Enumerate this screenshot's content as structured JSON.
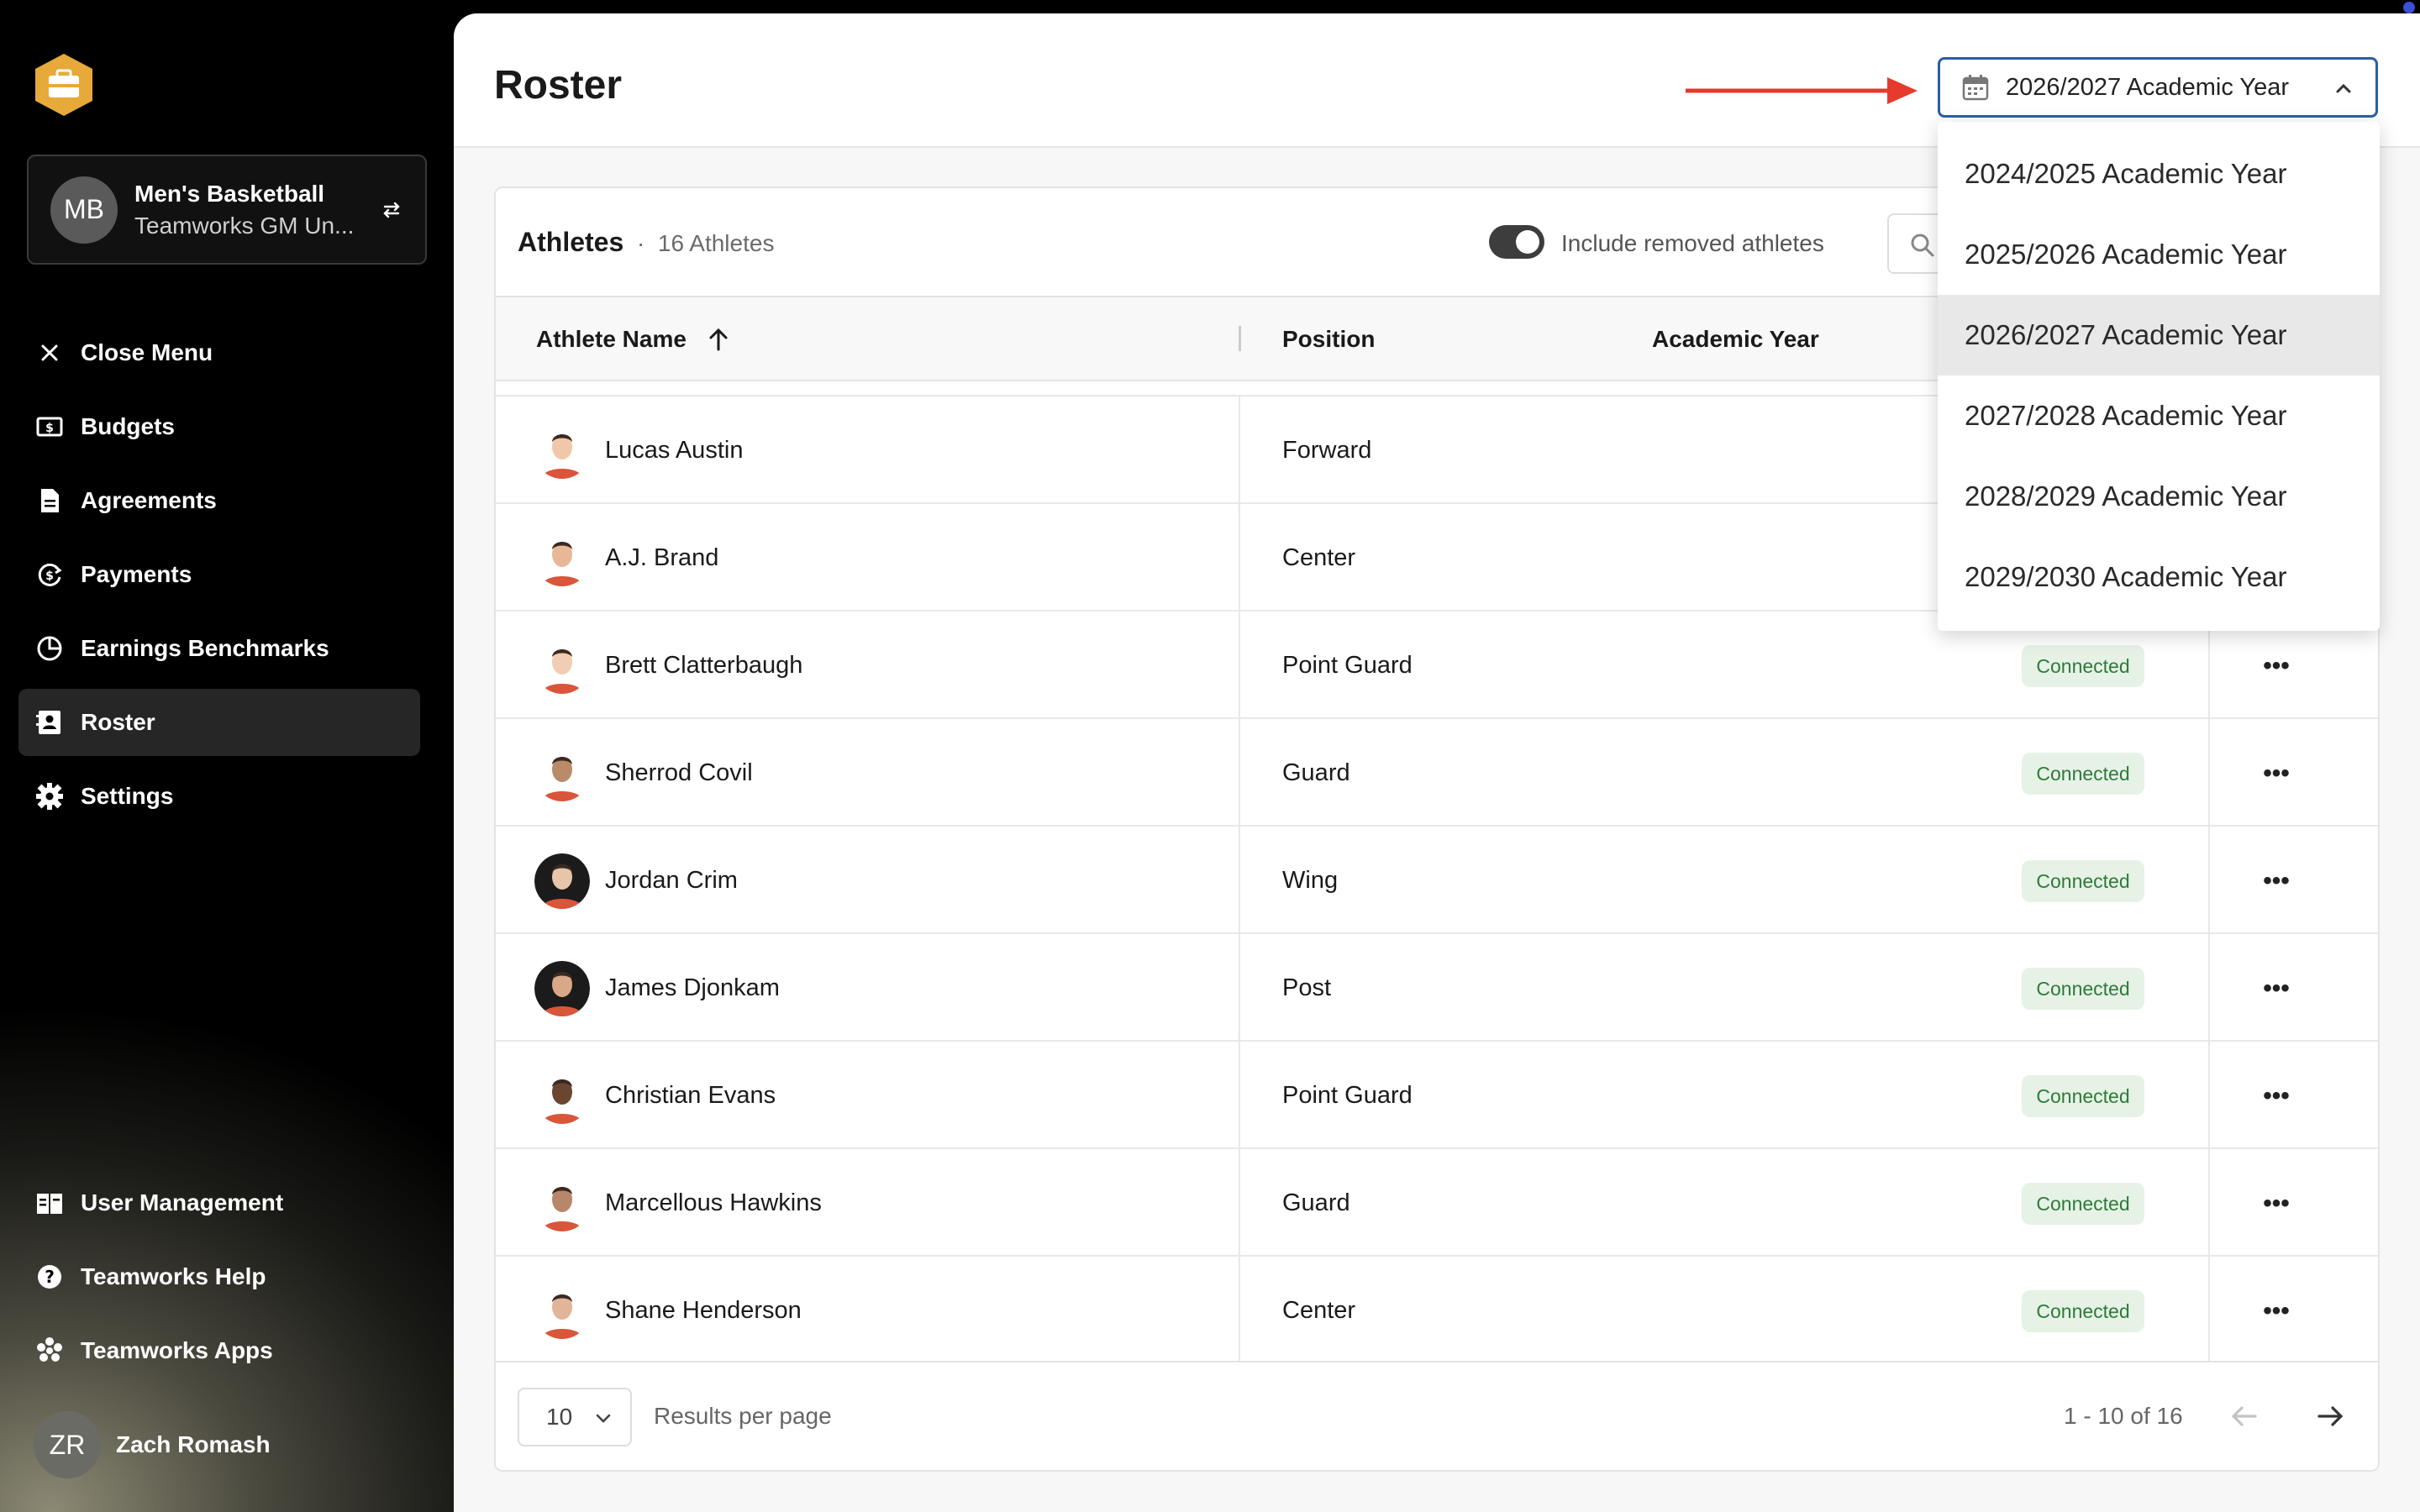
{
  "sidebar": {
    "team": {
      "initials": "MB",
      "name": "Men's Basketball",
      "org": "Teamworks GM Un..."
    },
    "nav": [
      {
        "label": "Close Menu",
        "icon": "close-icon"
      },
      {
        "label": "Budgets",
        "icon": "budget-icon"
      },
      {
        "label": "Agreements",
        "icon": "document-icon"
      },
      {
        "label": "Payments",
        "icon": "payments-icon"
      },
      {
        "label": "Earnings Benchmarks",
        "icon": "pie-chart-icon"
      },
      {
        "label": "Roster",
        "icon": "roster-icon",
        "active": true
      },
      {
        "label": "Settings",
        "icon": "gear-icon"
      }
    ],
    "nav_bottom": [
      {
        "label": "User Management",
        "icon": "user-management-icon"
      },
      {
        "label": "Teamworks Help",
        "icon": "help-icon"
      },
      {
        "label": "Teamworks Apps",
        "icon": "apps-icon"
      }
    ],
    "user": {
      "initials": "ZR",
      "name": "Zach Romash"
    }
  },
  "header": {
    "title": "Roster",
    "year_selector": "2026/2027 Academic Year"
  },
  "athletes_card": {
    "title": "Athletes",
    "count": "16 Athletes",
    "separator": "·",
    "toggle_label": "Include removed athletes",
    "toggle_on": true,
    "columns": {
      "name": "Athlete Name",
      "position": "Position",
      "academic_year": "Academic Year"
    },
    "rows": [
      {
        "name": "Lucas Austin",
        "position": "Forward",
        "status": "",
        "skin": "#f0c7a8",
        "bg": "#fff"
      },
      {
        "name": "A.J. Brand",
        "position": "Center",
        "status": "",
        "skin": "#e8b896",
        "bg": "#fff"
      },
      {
        "name": "Brett Clatterbaugh",
        "position": "Point Guard",
        "status": "Connected",
        "skin": "#f2cdb3",
        "bg": "#fff"
      },
      {
        "name": "Sherrod Covil",
        "position": "Guard",
        "status": "Connected",
        "skin": "#b98b6b",
        "bg": "#fff"
      },
      {
        "name": "Jordan Crim",
        "position": "Wing",
        "status": "Connected",
        "skin": "#e8c4a8",
        "bg": "#1b1b1b"
      },
      {
        "name": "James Djonkam",
        "position": "Post",
        "status": "Connected",
        "skin": "#d8a888",
        "bg": "#1b1b1b"
      },
      {
        "name": "Christian Evans",
        "position": "Point Guard",
        "status": "Connected",
        "skin": "#6a4530",
        "bg": "#fff"
      },
      {
        "name": "Marcellous Hawkins",
        "position": "Guard",
        "status": "Connected",
        "skin": "#b8866a",
        "bg": "#fff"
      },
      {
        "name": "Shane Henderson",
        "position": "Center",
        "status": "Connected",
        "skin": "#e2b598",
        "bg": "#fff"
      }
    ],
    "more_label": "•••",
    "footer": {
      "per_page": "10",
      "per_page_label": "Results per page",
      "range": "1 - 10 of 16"
    }
  },
  "year_dropdown": {
    "options": [
      "2024/2025 Academic Year",
      "2025/2026 Academic Year",
      "2026/2027 Academic Year",
      "2027/2028 Academic Year",
      "2028/2029 Academic Year",
      "2029/2030 Academic Year"
    ],
    "selected_index": 2
  },
  "colors": {
    "accent_blue": "#2a5ea6",
    "arrow_red": "#e53a2c",
    "status_green": "#2f7a3a",
    "logo_gold": "#e7a93a"
  }
}
